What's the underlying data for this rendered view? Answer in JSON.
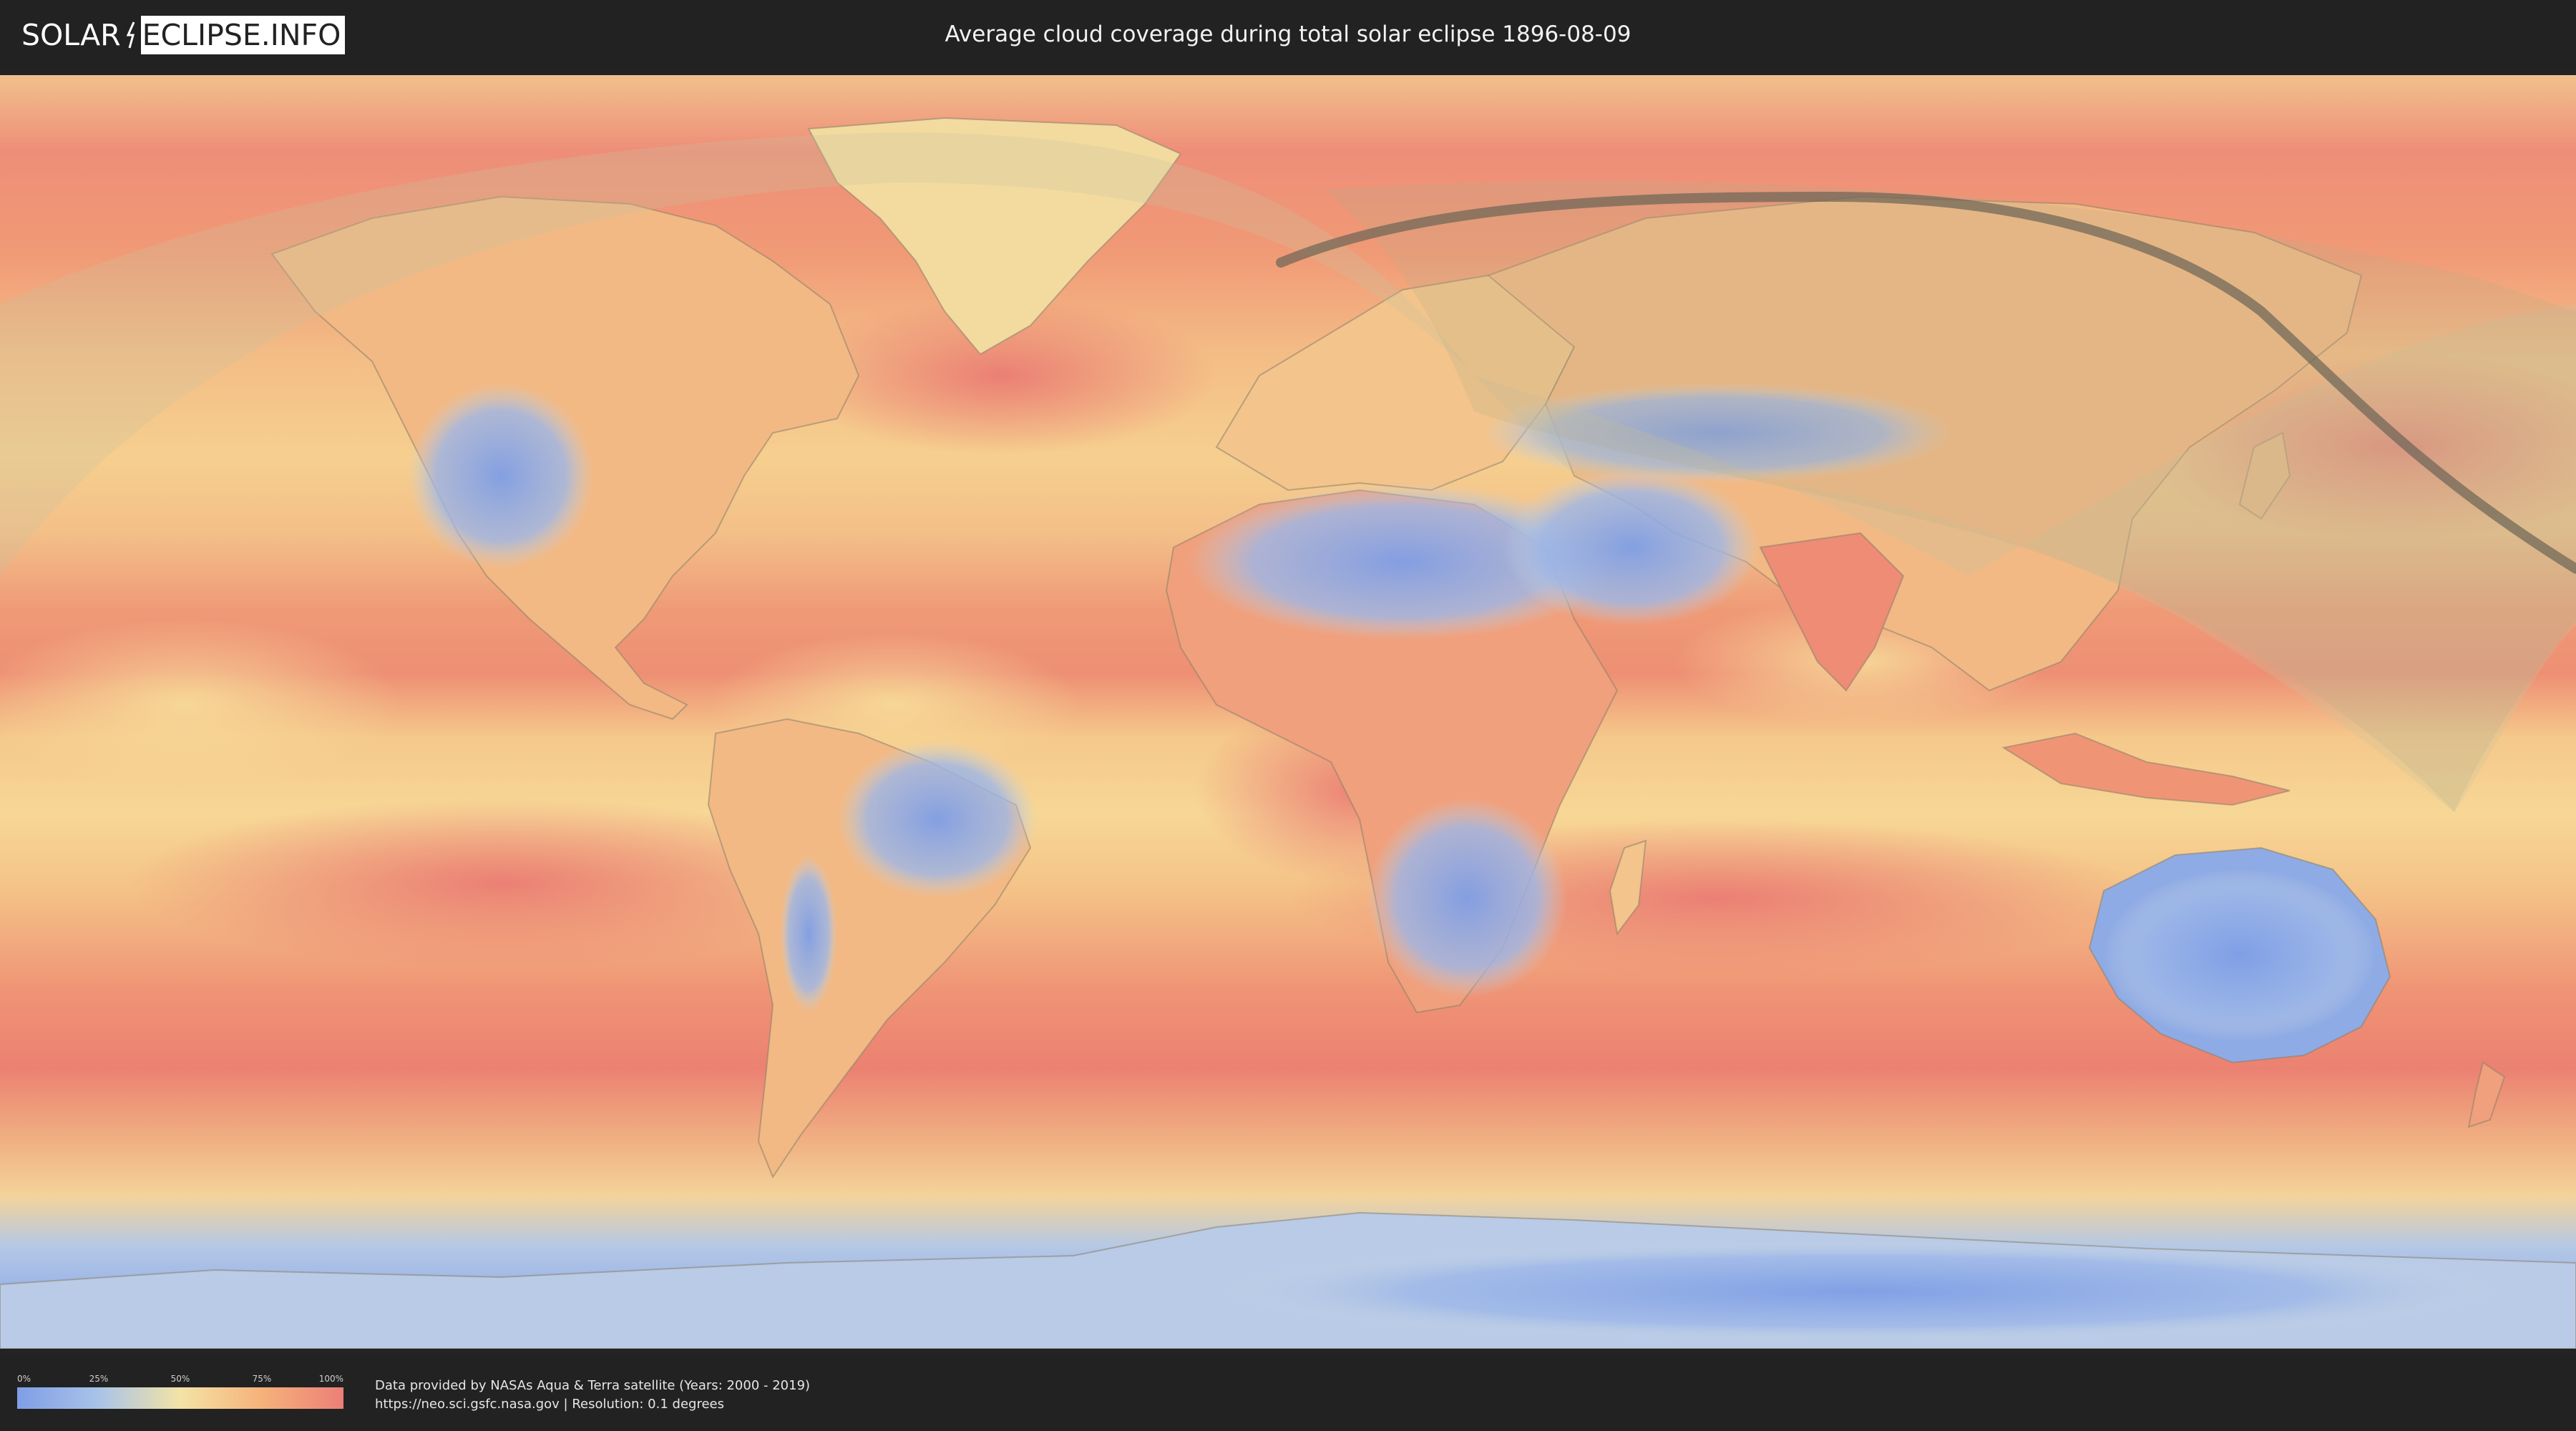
{
  "header": {
    "logo_left": "SOLAR",
    "logo_right": "ECLIPSE.INFO",
    "title": "Average cloud coverage during total solar eclipse 1896-08-09"
  },
  "map": {
    "description_icon": "world-map",
    "colors": {
      "clear": "#7f9ee6",
      "low": "#a9c3e8",
      "mid": "#f3e3a6",
      "high": "#f5b27a",
      "overcast": "#ec7f78",
      "eclipse_path": "#6b6455",
      "visibility_zone": "#d7cfa8",
      "borders": "#8a7f6a"
    }
  },
  "legend": {
    "labels": [
      "0%",
      "25%",
      "50%",
      "75%",
      "100%"
    ]
  },
  "footer": {
    "credit_line1": "Data provided by NASAs Aqua & Terra satellite (Years: 2000 - 2019)",
    "credit_line2": "https://neo.sci.gsfc.nasa.gov | Resolution: 0.1 degrees"
  }
}
